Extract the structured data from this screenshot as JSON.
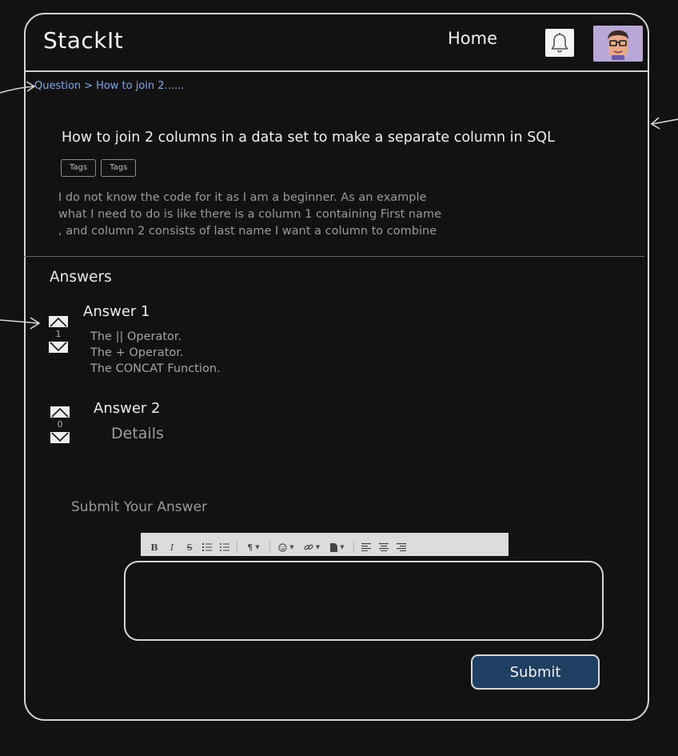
{
  "app": {
    "logo": "StackIt"
  },
  "nav": {
    "home_label": "Home",
    "icons": [
      "bell-icon",
      "user-avatar"
    ]
  },
  "breadcrumb": {
    "root": "Question",
    "separator": ">",
    "current": "How to join 2......"
  },
  "question": {
    "title": "How to join 2 columns in a data set to make a separate column in SQL",
    "tags": [
      "Tags",
      "Tags"
    ],
    "description_lines": [
      "I do not know the code for it as I am a beginner. As an example",
      "what I need to do is like there is a column 1 containing First name",
      ", and column 2 consists of last name I want a column to combine"
    ]
  },
  "answers": {
    "heading": "Answers",
    "items": [
      {
        "title": "Answer 1",
        "votes": "1",
        "lines": [
          "The || Operator.",
          "The + Operator.",
          "The CONCAT Function."
        ]
      },
      {
        "title": "Answer 2",
        "votes": "0",
        "details": "Details"
      }
    ]
  },
  "submit_section": {
    "heading": "Submit Your Answer",
    "button_label": "Submit"
  },
  "editor_toolbar": {
    "bold": "B",
    "italic": "I",
    "strike": "S",
    "paragraph": "¶",
    "icons": [
      "bold-icon",
      "italic-icon",
      "strikethrough-icon",
      "ordered-list-icon",
      "bullet-list-icon",
      "paragraph-icon",
      "emoji-icon",
      "link-icon",
      "file-icon",
      "align-left-icon",
      "align-center-icon",
      "align-right-icon"
    ]
  },
  "colors": {
    "background": "#121212",
    "link": "#7fa8e6",
    "submit_button": "#1f3f63",
    "avatar_bg": "#b9a8d6"
  }
}
